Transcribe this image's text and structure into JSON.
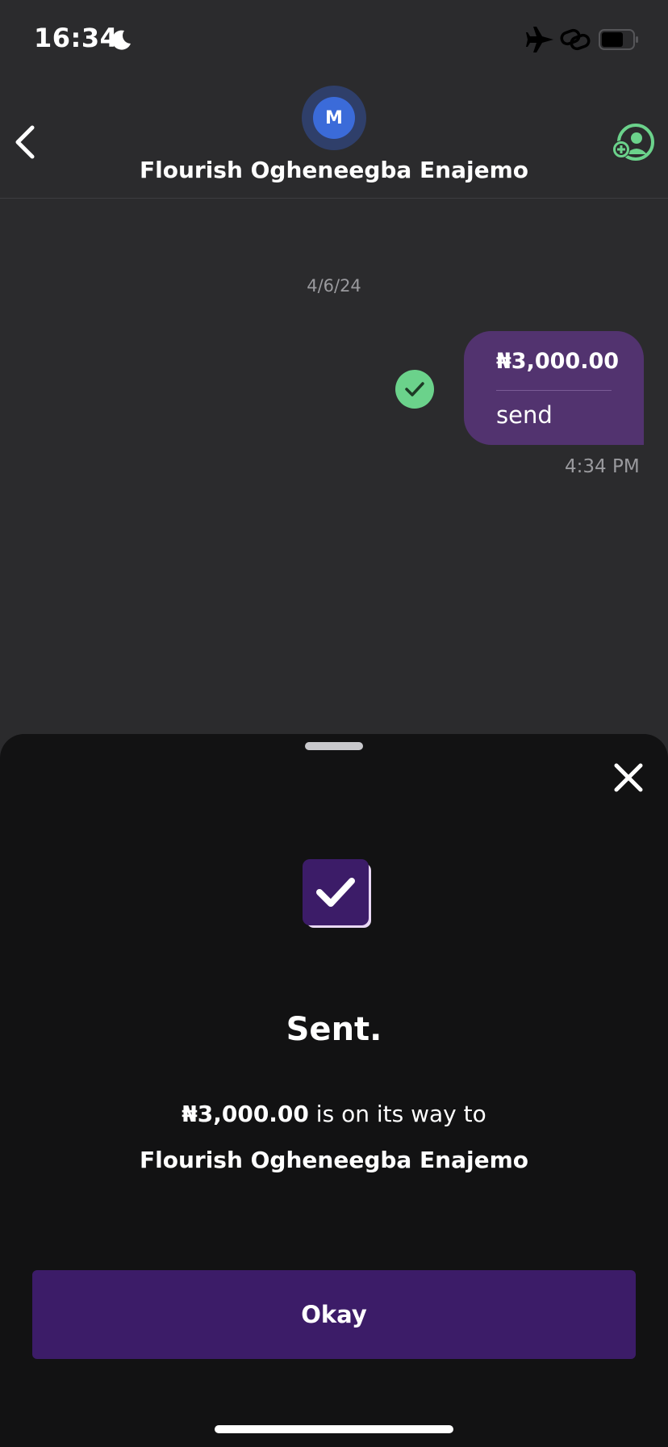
{
  "status_bar": {
    "time": "16:34",
    "icons": [
      "moon-icon",
      "airplane-icon",
      "link-icon",
      "battery-icon"
    ]
  },
  "header": {
    "avatar_initial": "M",
    "contact_name": "Flourish Ogheneegba Enajemo",
    "icons": [
      "back-icon",
      "add-user-icon"
    ]
  },
  "chat": {
    "date": "4/6/24",
    "message": {
      "amount": "₦3,000.00",
      "note": "send",
      "time": "4:34 PM",
      "status_icon": "check-circle-icon"
    }
  },
  "sheet": {
    "title": "Sent.",
    "amount": "₦3,000.00",
    "message_suffix": " is on its way to",
    "recipient": "Flourish Ogheneegba Enajemo",
    "button_label": "Okay",
    "icons": [
      "close-icon",
      "success-check-icon"
    ]
  },
  "colors": {
    "background": "#2b2b2d",
    "sheet": "#121213",
    "bubble": "#52336f",
    "button": "#3c1c68",
    "accent_green": "#6bd28b",
    "avatar_blue": "#3b6bd9"
  }
}
